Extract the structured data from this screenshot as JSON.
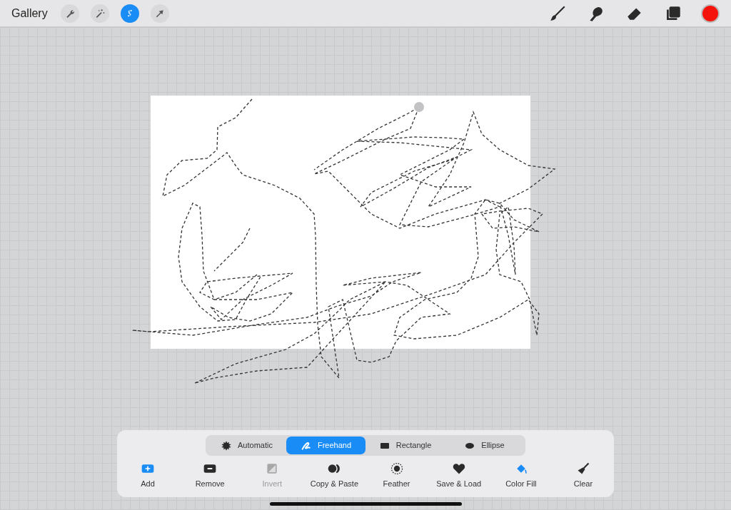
{
  "top_bar": {
    "gallery": "Gallery",
    "left_tools": [
      {
        "kind": "wrench",
        "selected": false
      },
      {
        "kind": "wand",
        "selected": false
      },
      {
        "kind": "selection",
        "selected": true
      },
      {
        "kind": "transform",
        "selected": false
      }
    ],
    "right_tools": [
      {
        "kind": "brush",
        "selected": false
      },
      {
        "kind": "smudge",
        "selected": false
      },
      {
        "kind": "eraser",
        "selected": false
      },
      {
        "kind": "layers",
        "selected": false
      }
    ]
  },
  "selection_modes": [
    {
      "kind": "automatic",
      "label": "Automatic",
      "selected": false
    },
    {
      "kind": "freehand",
      "label": "Freehand",
      "selected": true
    },
    {
      "kind": "rectangle",
      "label": "Rectangle",
      "selected": false
    },
    {
      "kind": "ellipse",
      "label": "Ellipse",
      "selected": false
    }
  ],
  "actions": [
    {
      "kind": "add",
      "label": "Add",
      "on": true,
      "disabled": false
    },
    {
      "kind": "remove",
      "label": "Remove",
      "on": false,
      "disabled": false
    },
    {
      "kind": "invert",
      "label": "Invert",
      "on": false,
      "disabled": true
    },
    {
      "kind": "copy",
      "label": "Copy & Paste",
      "on": false,
      "disabled": false
    },
    {
      "kind": "feather",
      "label": "Feather",
      "on": false,
      "disabled": false
    },
    {
      "kind": "save",
      "label": "Save & Load",
      "on": false,
      "disabled": false
    },
    {
      "kind": "fill",
      "label": "Color Fill",
      "on": true,
      "disabled": false
    },
    {
      "kind": "clear",
      "label": "Clear",
      "on": false,
      "disabled": false
    }
  ]
}
